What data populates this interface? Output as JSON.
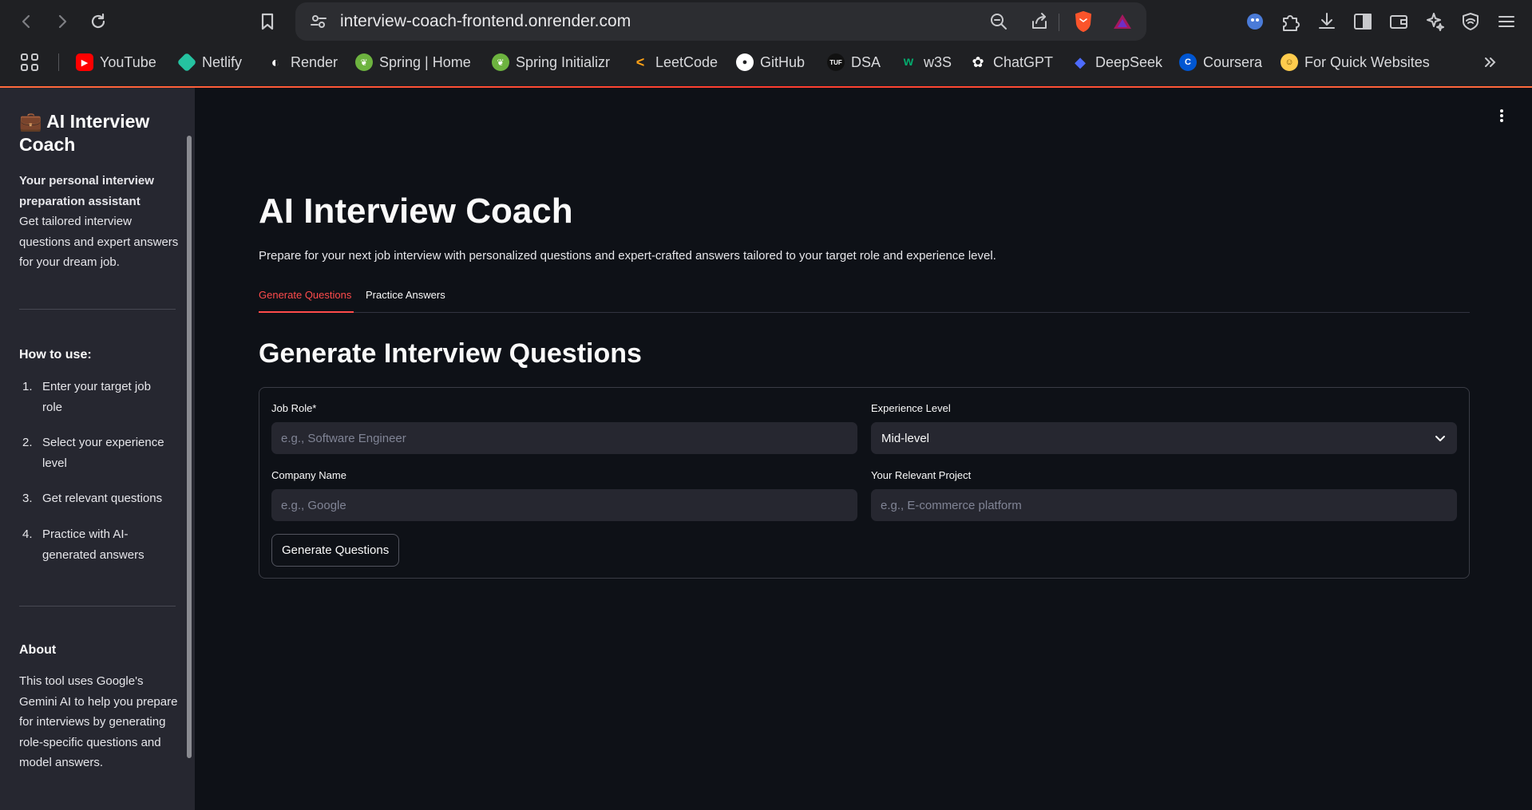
{
  "browser": {
    "url": "interview-coach-frontend.onrender.com",
    "bookmarks": [
      {
        "label": "YouTube",
        "icon": "youtube-icon",
        "color": "#ff0000"
      },
      {
        "label": "Netlify",
        "icon": "netlify-icon",
        "color": "#25c2a0"
      },
      {
        "label": "Render",
        "icon": "render-icon",
        "color": "#ffffff"
      },
      {
        "label": "Spring | Home",
        "icon": "spring-icon",
        "color": "#6db33f"
      },
      {
        "label": "Spring Initializr",
        "icon": "spring-icon",
        "color": "#6db33f"
      },
      {
        "label": "LeetCode",
        "icon": "leetcode-icon",
        "color": "#ffa116"
      },
      {
        "label": "GitHub",
        "icon": "github-icon",
        "color": "#ffffff"
      },
      {
        "label": "DSA",
        "icon": "tuf-icon",
        "color": "#111111"
      },
      {
        "label": "w3S",
        "icon": "w3schools-icon",
        "color": "#04aa6d"
      },
      {
        "label": "ChatGPT",
        "icon": "chatgpt-icon",
        "color": "#ffffff"
      },
      {
        "label": "DeepSeek",
        "icon": "deepseek-icon",
        "color": "#4d6bfe"
      },
      {
        "label": "Coursera",
        "icon": "coursera-icon",
        "color": "#0056d2"
      },
      {
        "label": "For Quick Websites",
        "icon": "hugging-face-icon",
        "color": "#ffcc4d"
      }
    ]
  },
  "sidebar": {
    "title": "💼 AI Interview Coach",
    "subtitle": "Your personal interview preparation assistant",
    "intro": "Get tailored interview questions and expert answers for your dream job.",
    "howto_heading": "How to use:",
    "steps": [
      {
        "num": "1.",
        "text": "Enter your target job role"
      },
      {
        "num": "2.",
        "text": "Select your experience level"
      },
      {
        "num": "3.",
        "text": "Get relevant questions"
      },
      {
        "num": "4.",
        "text": "Practice with AI-generated answers"
      }
    ],
    "about_heading": "About",
    "about_text": "This tool uses Google's Gemini AI to help you prepare for interviews by generating role-specific questions and model answers."
  },
  "main": {
    "title": "AI Interview Coach",
    "description": "Prepare for your next job interview with personalized questions and expert-crafted answers tailored to your target role and experience level.",
    "tabs": [
      {
        "label": "Generate Questions",
        "active": true
      },
      {
        "label": "Practice Answers",
        "active": false
      }
    ],
    "section_title": "Generate Interview Questions",
    "form": {
      "job_role_label": "Job Role*",
      "job_role_placeholder": "e.g., Software Engineer",
      "experience_label": "Experience Level",
      "experience_value": "Mid-level",
      "company_label": "Company Name",
      "company_placeholder": "e.g., Google",
      "project_label": "Your Relevant Project",
      "project_placeholder": "e.g., E-commerce platform",
      "submit_label": "Generate Questions"
    }
  },
  "colors": {
    "accent": "#ff4b4b",
    "background": "#0e1117",
    "sidebar_bg": "#262730"
  }
}
